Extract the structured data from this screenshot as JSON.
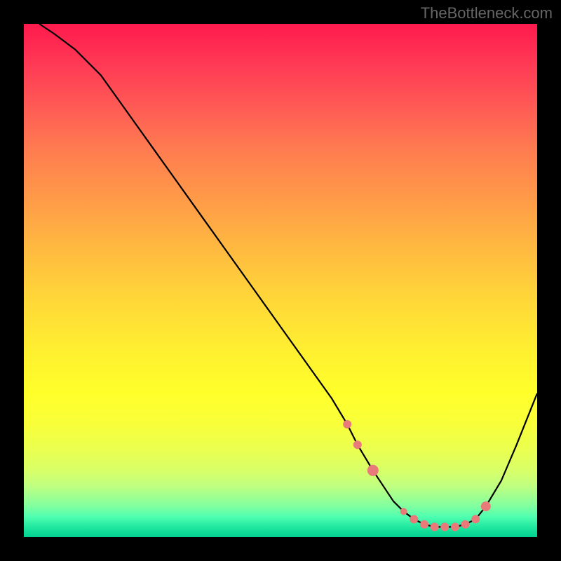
{
  "watermark": "TheBottleneck.com",
  "chart_data": {
    "type": "line",
    "title": "",
    "xlabel": "",
    "ylabel": "",
    "xlim": [
      0,
      100
    ],
    "ylim": [
      0,
      100
    ],
    "series": [
      {
        "name": "curve",
        "x": [
          3,
          6,
          10,
          15,
          20,
          25,
          30,
          35,
          40,
          45,
          50,
          55,
          60,
          63,
          65,
          68,
          70,
          72,
          74,
          76,
          78,
          80,
          82,
          84,
          86,
          88,
          90,
          93,
          96,
          100
        ],
        "y": [
          100,
          98,
          95,
          90,
          83,
          76,
          69,
          62,
          55,
          48,
          41,
          34,
          27,
          22,
          18,
          13,
          10,
          7,
          5,
          3.5,
          2.5,
          2,
          2,
          2,
          2.5,
          3.5,
          6,
          11,
          18,
          28
        ]
      }
    ],
    "markers": {
      "name": "highlighted-points",
      "x": [
        63,
        65,
        68,
        74,
        76,
        78,
        80,
        82,
        84,
        86,
        88,
        90
      ],
      "y": [
        22,
        18,
        13,
        5,
        3.5,
        2.5,
        2,
        2,
        2,
        2.5,
        3.5,
        6
      ],
      "r": [
        6,
        6,
        8,
        5,
        6,
        6,
        6,
        6,
        6,
        6,
        6,
        7
      ]
    },
    "background_gradient": {
      "direction": "vertical",
      "stops": [
        {
          "pos": 0.0,
          "color": "#ff1a4d"
        },
        {
          "pos": 0.5,
          "color": "#ffd838"
        },
        {
          "pos": 0.75,
          "color": "#ffff2a"
        },
        {
          "pos": 1.0,
          "color": "#00d090"
        }
      ]
    }
  }
}
